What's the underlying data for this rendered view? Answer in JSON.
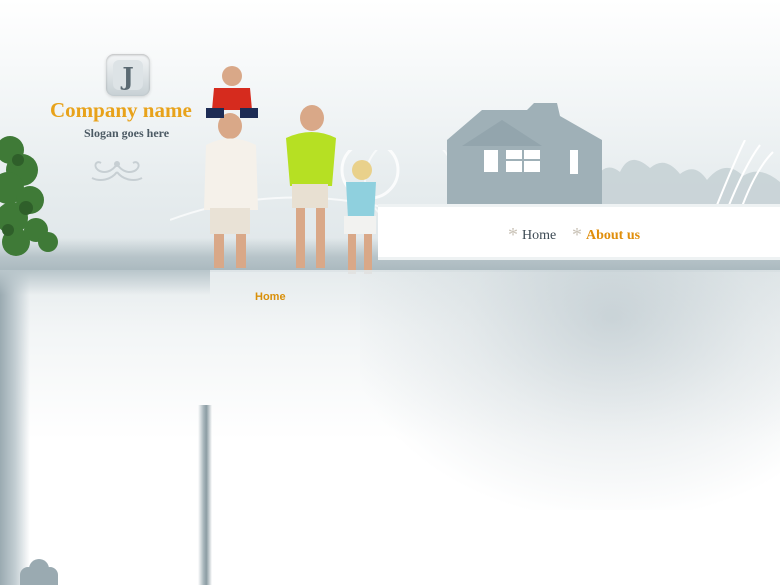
{
  "brand": {
    "company_name": "Company name",
    "slogan": "Slogan goes here",
    "logo_letter": "J"
  },
  "nav": {
    "items": [
      {
        "label": "Home",
        "active": false
      },
      {
        "label": "About us",
        "active": true
      }
    ],
    "separator": "*"
  },
  "content": {
    "breadcrumb": "Home"
  },
  "colors": {
    "accent": "#e8a21a",
    "text_dark": "#3e4b55",
    "grunge": "#9aaab1"
  },
  "icons": {
    "logo": "j-logo-icon",
    "nav_bullet": "asterisk-icon",
    "ornament": "flourish-icon"
  }
}
